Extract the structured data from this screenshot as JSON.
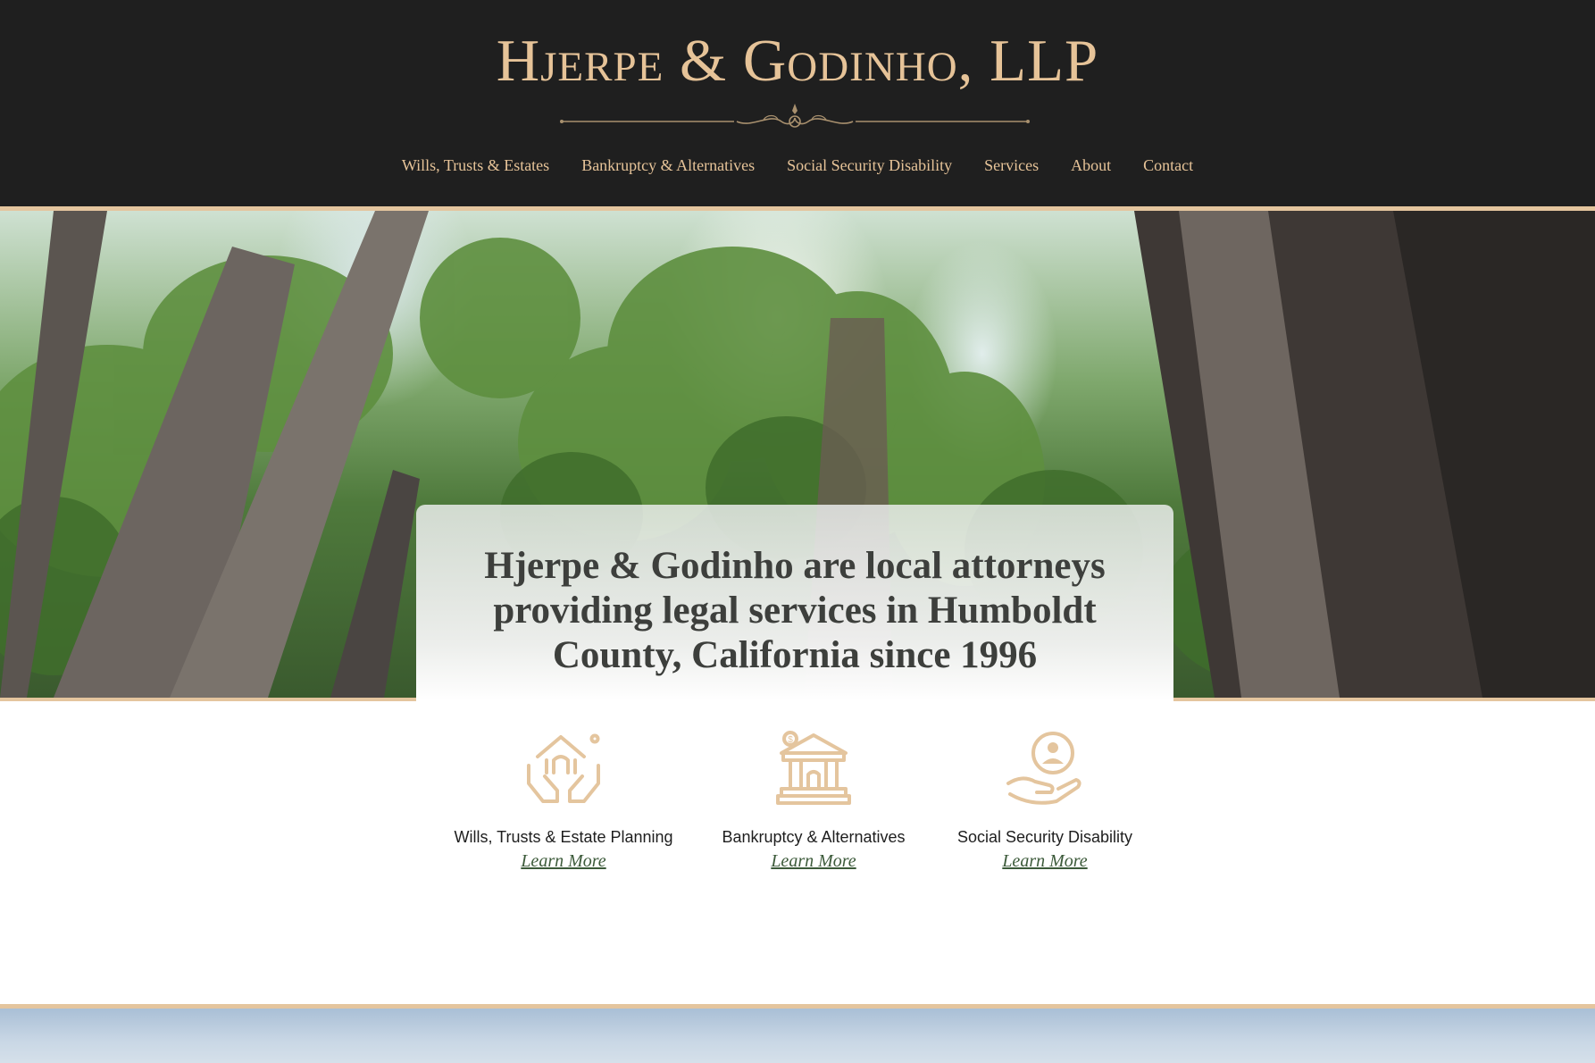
{
  "header": {
    "logo": "Hjerpe & Godinho, LLP",
    "nav": [
      "Wills, Trusts & Estates",
      "Bankruptcy & Alternatives",
      "Social Security Disability",
      "Services",
      "About",
      "Contact"
    ]
  },
  "hero": {
    "tagline": "Hjerpe & Godinho are local attorneys providing legal services in Humboldt County, California since 1996"
  },
  "services": [
    {
      "title": "Wills, Trusts & Estate Planning",
      "link": "Learn More",
      "icon": "house-hands-icon"
    },
    {
      "title": "Bankruptcy & Alternatives",
      "link": "Learn More",
      "icon": "bank-dollar-icon"
    },
    {
      "title": "Social Security Disability",
      "link": "Learn More",
      "icon": "hand-person-icon"
    }
  ],
  "colors": {
    "header_bg": "#1f1f1f",
    "gold": "#e6c398",
    "link_green": "#3c5a3a"
  }
}
